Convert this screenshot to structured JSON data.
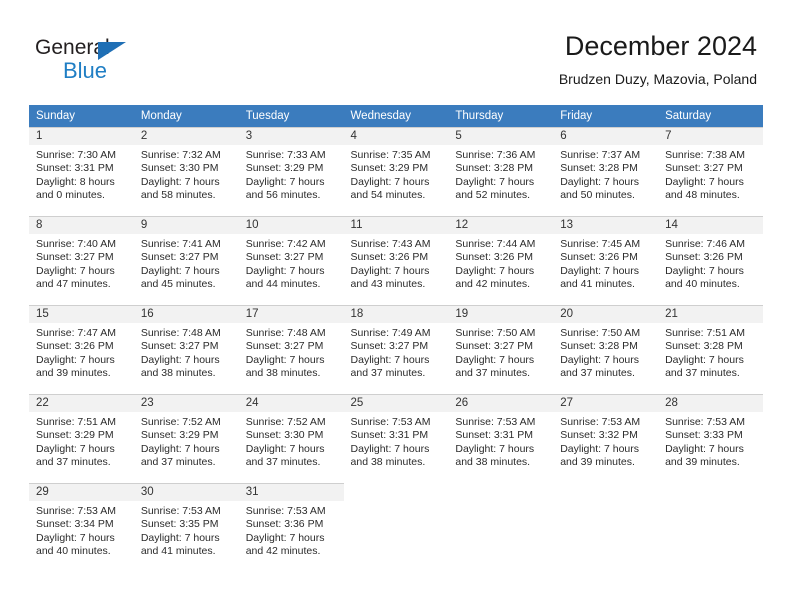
{
  "brand": {
    "name_dark": "General",
    "name_blue": "Blue",
    "accent_color": "#1f7ec4",
    "triangle_color": "#1f6fb5"
  },
  "header": {
    "title": "December 2024",
    "subtitle": "Brudzen Duzy, Mazovia, Poland"
  },
  "calendar": {
    "header_bg": "#3b7cbe",
    "daynum_bg": "#f2f2f2",
    "weekday_headers": [
      "Sunday",
      "Monday",
      "Tuesday",
      "Wednesday",
      "Thursday",
      "Friday",
      "Saturday"
    ],
    "weeks": [
      [
        {
          "day": "1",
          "sunrise": "Sunrise: 7:30 AM",
          "sunset": "Sunset: 3:31 PM",
          "daylight1": "Daylight: 8 hours",
          "daylight2": "and 0 minutes."
        },
        {
          "day": "2",
          "sunrise": "Sunrise: 7:32 AM",
          "sunset": "Sunset: 3:30 PM",
          "daylight1": "Daylight: 7 hours",
          "daylight2": "and 58 minutes."
        },
        {
          "day": "3",
          "sunrise": "Sunrise: 7:33 AM",
          "sunset": "Sunset: 3:29 PM",
          "daylight1": "Daylight: 7 hours",
          "daylight2": "and 56 minutes."
        },
        {
          "day": "4",
          "sunrise": "Sunrise: 7:35 AM",
          "sunset": "Sunset: 3:29 PM",
          "daylight1": "Daylight: 7 hours",
          "daylight2": "and 54 minutes."
        },
        {
          "day": "5",
          "sunrise": "Sunrise: 7:36 AM",
          "sunset": "Sunset: 3:28 PM",
          "daylight1": "Daylight: 7 hours",
          "daylight2": "and 52 minutes."
        },
        {
          "day": "6",
          "sunrise": "Sunrise: 7:37 AM",
          "sunset": "Sunset: 3:28 PM",
          "daylight1": "Daylight: 7 hours",
          "daylight2": "and 50 minutes."
        },
        {
          "day": "7",
          "sunrise": "Sunrise: 7:38 AM",
          "sunset": "Sunset: 3:27 PM",
          "daylight1": "Daylight: 7 hours",
          "daylight2": "and 48 minutes."
        }
      ],
      [
        {
          "day": "8",
          "sunrise": "Sunrise: 7:40 AM",
          "sunset": "Sunset: 3:27 PM",
          "daylight1": "Daylight: 7 hours",
          "daylight2": "and 47 minutes."
        },
        {
          "day": "9",
          "sunrise": "Sunrise: 7:41 AM",
          "sunset": "Sunset: 3:27 PM",
          "daylight1": "Daylight: 7 hours",
          "daylight2": "and 45 minutes."
        },
        {
          "day": "10",
          "sunrise": "Sunrise: 7:42 AM",
          "sunset": "Sunset: 3:27 PM",
          "daylight1": "Daylight: 7 hours",
          "daylight2": "and 44 minutes."
        },
        {
          "day": "11",
          "sunrise": "Sunrise: 7:43 AM",
          "sunset": "Sunset: 3:26 PM",
          "daylight1": "Daylight: 7 hours",
          "daylight2": "and 43 minutes."
        },
        {
          "day": "12",
          "sunrise": "Sunrise: 7:44 AM",
          "sunset": "Sunset: 3:26 PM",
          "daylight1": "Daylight: 7 hours",
          "daylight2": "and 42 minutes."
        },
        {
          "day": "13",
          "sunrise": "Sunrise: 7:45 AM",
          "sunset": "Sunset: 3:26 PM",
          "daylight1": "Daylight: 7 hours",
          "daylight2": "and 41 minutes."
        },
        {
          "day": "14",
          "sunrise": "Sunrise: 7:46 AM",
          "sunset": "Sunset: 3:26 PM",
          "daylight1": "Daylight: 7 hours",
          "daylight2": "and 40 minutes."
        }
      ],
      [
        {
          "day": "15",
          "sunrise": "Sunrise: 7:47 AM",
          "sunset": "Sunset: 3:26 PM",
          "daylight1": "Daylight: 7 hours",
          "daylight2": "and 39 minutes."
        },
        {
          "day": "16",
          "sunrise": "Sunrise: 7:48 AM",
          "sunset": "Sunset: 3:27 PM",
          "daylight1": "Daylight: 7 hours",
          "daylight2": "and 38 minutes."
        },
        {
          "day": "17",
          "sunrise": "Sunrise: 7:48 AM",
          "sunset": "Sunset: 3:27 PM",
          "daylight1": "Daylight: 7 hours",
          "daylight2": "and 38 minutes."
        },
        {
          "day": "18",
          "sunrise": "Sunrise: 7:49 AM",
          "sunset": "Sunset: 3:27 PM",
          "daylight1": "Daylight: 7 hours",
          "daylight2": "and 37 minutes."
        },
        {
          "day": "19",
          "sunrise": "Sunrise: 7:50 AM",
          "sunset": "Sunset: 3:27 PM",
          "daylight1": "Daylight: 7 hours",
          "daylight2": "and 37 minutes."
        },
        {
          "day": "20",
          "sunrise": "Sunrise: 7:50 AM",
          "sunset": "Sunset: 3:28 PM",
          "daylight1": "Daylight: 7 hours",
          "daylight2": "and 37 minutes."
        },
        {
          "day": "21",
          "sunrise": "Sunrise: 7:51 AM",
          "sunset": "Sunset: 3:28 PM",
          "daylight1": "Daylight: 7 hours",
          "daylight2": "and 37 minutes."
        }
      ],
      [
        {
          "day": "22",
          "sunrise": "Sunrise: 7:51 AM",
          "sunset": "Sunset: 3:29 PM",
          "daylight1": "Daylight: 7 hours",
          "daylight2": "and 37 minutes."
        },
        {
          "day": "23",
          "sunrise": "Sunrise: 7:52 AM",
          "sunset": "Sunset: 3:29 PM",
          "daylight1": "Daylight: 7 hours",
          "daylight2": "and 37 minutes."
        },
        {
          "day": "24",
          "sunrise": "Sunrise: 7:52 AM",
          "sunset": "Sunset: 3:30 PM",
          "daylight1": "Daylight: 7 hours",
          "daylight2": "and 37 minutes."
        },
        {
          "day": "25",
          "sunrise": "Sunrise: 7:53 AM",
          "sunset": "Sunset: 3:31 PM",
          "daylight1": "Daylight: 7 hours",
          "daylight2": "and 38 minutes."
        },
        {
          "day": "26",
          "sunrise": "Sunrise: 7:53 AM",
          "sunset": "Sunset: 3:31 PM",
          "daylight1": "Daylight: 7 hours",
          "daylight2": "and 38 minutes."
        },
        {
          "day": "27",
          "sunrise": "Sunrise: 7:53 AM",
          "sunset": "Sunset: 3:32 PM",
          "daylight1": "Daylight: 7 hours",
          "daylight2": "and 39 minutes."
        },
        {
          "day": "28",
          "sunrise": "Sunrise: 7:53 AM",
          "sunset": "Sunset: 3:33 PM",
          "daylight1": "Daylight: 7 hours",
          "daylight2": "and 39 minutes."
        }
      ],
      [
        {
          "day": "29",
          "sunrise": "Sunrise: 7:53 AM",
          "sunset": "Sunset: 3:34 PM",
          "daylight1": "Daylight: 7 hours",
          "daylight2": "and 40 minutes."
        },
        {
          "day": "30",
          "sunrise": "Sunrise: 7:53 AM",
          "sunset": "Sunset: 3:35 PM",
          "daylight1": "Daylight: 7 hours",
          "daylight2": "and 41 minutes."
        },
        {
          "day": "31",
          "sunrise": "Sunrise: 7:53 AM",
          "sunset": "Sunset: 3:36 PM",
          "daylight1": "Daylight: 7 hours",
          "daylight2": "and 42 minutes."
        },
        null,
        null,
        null,
        null
      ]
    ]
  }
}
